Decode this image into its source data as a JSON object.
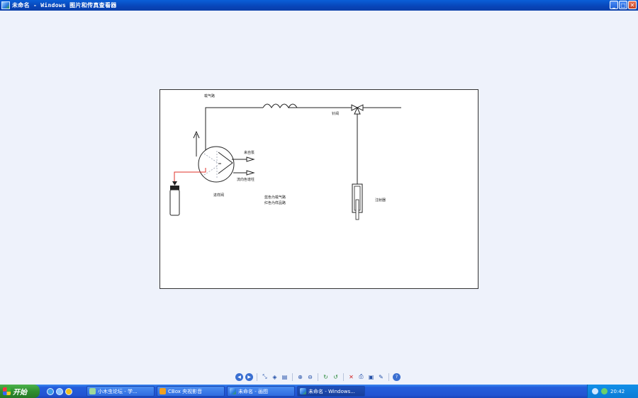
{
  "window": {
    "title": "未命名 - Windows 图片和传真查看器",
    "min": "_",
    "max": "□",
    "close": "✕"
  },
  "diagram": {
    "labels": {
      "top_left": "载气路",
      "valve": "进样阀",
      "to_column": "流向色谱柱",
      "from_pump": "来自泵",
      "legend_line1": "蓝色为载气路",
      "legend_line2": "红色为样品路",
      "syringe": "注射器",
      "needle_valve": "针阀"
    },
    "colors": {
      "sample_line": "#e0302a",
      "gas_line": "#222222",
      "port_dash": "#9aa0b0"
    }
  },
  "toolbar": {
    "buttons": [
      {
        "name": "previous-image-button",
        "glyph": "◀"
      },
      {
        "name": "next-image-button",
        "glyph": "▶"
      },
      {
        "name": "best-fit-button",
        "glyph": "⤡"
      },
      {
        "name": "actual-size-button",
        "glyph": "◈"
      },
      {
        "name": "slideshow-button",
        "glyph": "▤"
      },
      {
        "name": "zoom-in-button",
        "glyph": "⊕"
      },
      {
        "name": "zoom-out-button",
        "glyph": "⊖"
      },
      {
        "name": "rotate-clockwise-button",
        "glyph": "↻"
      },
      {
        "name": "rotate-counterclockwise-button",
        "glyph": "↺"
      },
      {
        "name": "delete-button",
        "glyph": "✕"
      },
      {
        "name": "print-button",
        "glyph": "⎙"
      },
      {
        "name": "save-button",
        "glyph": "▣"
      },
      {
        "name": "edit-button",
        "glyph": "✎"
      },
      {
        "name": "help-button",
        "glyph": "?"
      }
    ]
  },
  "taskbar": {
    "start_label": "开始",
    "tasks": [
      {
        "label": "小木虫论坛 - 学...",
        "icon": "browser-icon"
      },
      {
        "label": "CBox 央视影音",
        "icon": "tv-icon"
      },
      {
        "label": "未命名 - 画图",
        "icon": "paint-icon"
      },
      {
        "label": "未命名 - Windows...",
        "icon": "image-viewer-icon"
      }
    ],
    "clock": "20:42"
  }
}
